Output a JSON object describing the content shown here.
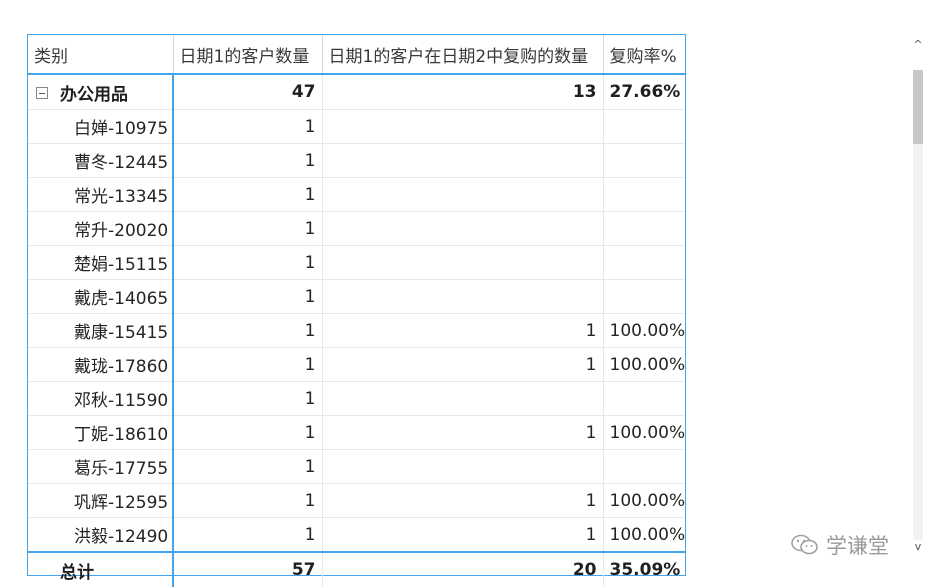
{
  "headers": [
    "类别",
    "日期1的客户数量",
    "日期1的客户在日期2中复购的数量",
    "复购率%"
  ],
  "group": {
    "label": "办公用品",
    "count": "47",
    "repurchase": "13",
    "rate": "27.66%"
  },
  "rows": [
    {
      "name": "白婵-10975",
      "count": "1",
      "repurchase": "",
      "rate": ""
    },
    {
      "name": "曹冬-12445",
      "count": "1",
      "repurchase": "",
      "rate": ""
    },
    {
      "name": "常光-13345",
      "count": "1",
      "repurchase": "",
      "rate": ""
    },
    {
      "name": "常升-20020",
      "count": "1",
      "repurchase": "",
      "rate": ""
    },
    {
      "name": "楚娟-15115",
      "count": "1",
      "repurchase": "",
      "rate": ""
    },
    {
      "name": "戴虎-14065",
      "count": "1",
      "repurchase": "",
      "rate": ""
    },
    {
      "name": "戴康-15415",
      "count": "1",
      "repurchase": "1",
      "rate": "100.00%"
    },
    {
      "name": "戴珑-17860",
      "count": "1",
      "repurchase": "1",
      "rate": "100.00%"
    },
    {
      "name": "邓秋-11590",
      "count": "1",
      "repurchase": "",
      "rate": ""
    },
    {
      "name": "丁妮-18610",
      "count": "1",
      "repurchase": "1",
      "rate": "100.00%"
    },
    {
      "name": "葛乐-17755",
      "count": "1",
      "repurchase": "",
      "rate": ""
    },
    {
      "name": "巩辉-12595",
      "count": "1",
      "repurchase": "1",
      "rate": "100.00%"
    },
    {
      "name": "洪毅-12490",
      "count": "1",
      "repurchase": "1",
      "rate": "100.00%"
    }
  ],
  "total": {
    "label": "总计",
    "count": "57",
    "repurchase": "20",
    "rate": "35.09%"
  },
  "scrollbar": {
    "up_glyph": "^",
    "down_glyph": "v"
  },
  "watermark": {
    "text": "学谦堂",
    "icon": "wechat-icon"
  },
  "colors": {
    "accent": "#41a5ee",
    "grid": "#e8e8e8"
  }
}
